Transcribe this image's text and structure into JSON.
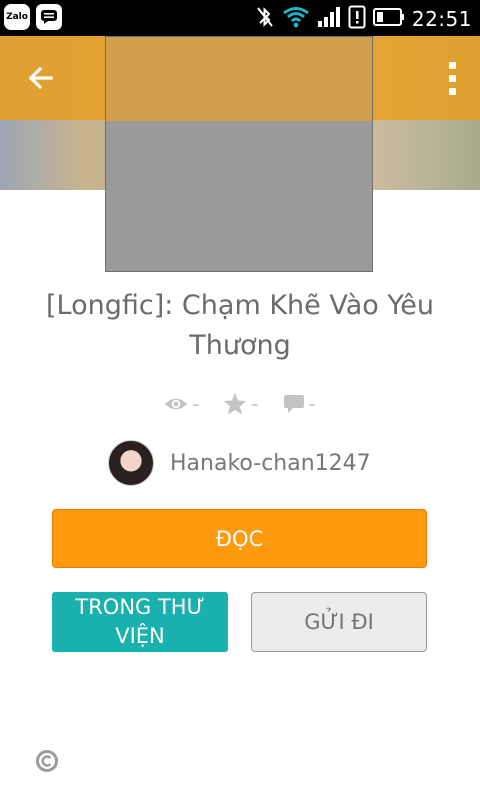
{
  "status_bar": {
    "zalo_label": "Zalo",
    "time": "22:51",
    "icons": [
      "zalo-icon",
      "chat-icon",
      "bluetooth-off-icon",
      "wifi-icon",
      "signal-icon",
      "alert-icon",
      "battery-icon"
    ]
  },
  "toolbar": {
    "back_icon": "arrow-left-icon",
    "menu_icon": "more-vert-icon"
  },
  "story": {
    "title": "[Longfic]: Chạm Khẽ Vào Yêu Thương",
    "reads": "-",
    "votes": "-",
    "comments": "-"
  },
  "author": {
    "name": "Hanako-chan1247"
  },
  "actions": {
    "read_label": "ĐỌC",
    "library_label": "TRONG THƯ VIỆN",
    "send_label": "GỬI ĐI"
  },
  "footer": {
    "license_icon": "copyright-icon"
  },
  "colors": {
    "accent": "#ff9a0f",
    "teal": "#18b1ad",
    "toolbar": "#e89c16"
  }
}
